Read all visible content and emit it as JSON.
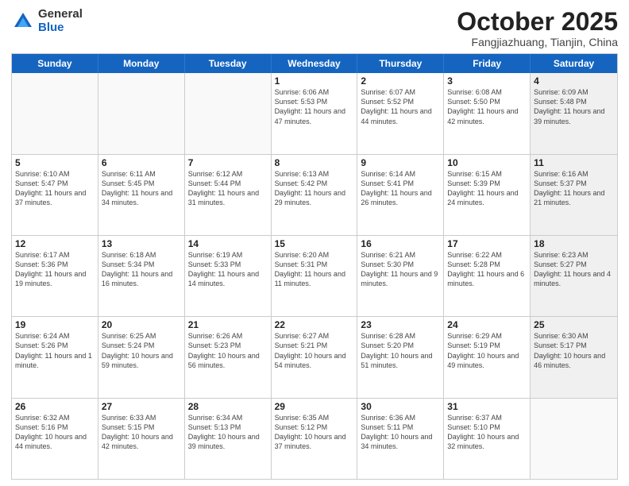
{
  "logo": {
    "general": "General",
    "blue": "Blue"
  },
  "title": "October 2025",
  "subtitle": "Fangjiazhuang, Tianjin, China",
  "days_of_week": [
    "Sunday",
    "Monday",
    "Tuesday",
    "Wednesday",
    "Thursday",
    "Friday",
    "Saturday"
  ],
  "weeks": [
    [
      {
        "day": "",
        "info": "",
        "empty": true
      },
      {
        "day": "",
        "info": "",
        "empty": true
      },
      {
        "day": "",
        "info": "",
        "empty": true
      },
      {
        "day": "1",
        "info": "Sunrise: 6:06 AM\nSunset: 5:53 PM\nDaylight: 11 hours and 47 minutes."
      },
      {
        "day": "2",
        "info": "Sunrise: 6:07 AM\nSunset: 5:52 PM\nDaylight: 11 hours and 44 minutes."
      },
      {
        "day": "3",
        "info": "Sunrise: 6:08 AM\nSunset: 5:50 PM\nDaylight: 11 hours and 42 minutes."
      },
      {
        "day": "4",
        "info": "Sunrise: 6:09 AM\nSunset: 5:48 PM\nDaylight: 11 hours and 39 minutes.",
        "shaded": true
      }
    ],
    [
      {
        "day": "5",
        "info": "Sunrise: 6:10 AM\nSunset: 5:47 PM\nDaylight: 11 hours and 37 minutes."
      },
      {
        "day": "6",
        "info": "Sunrise: 6:11 AM\nSunset: 5:45 PM\nDaylight: 11 hours and 34 minutes."
      },
      {
        "day": "7",
        "info": "Sunrise: 6:12 AM\nSunset: 5:44 PM\nDaylight: 11 hours and 31 minutes."
      },
      {
        "day": "8",
        "info": "Sunrise: 6:13 AM\nSunset: 5:42 PM\nDaylight: 11 hours and 29 minutes."
      },
      {
        "day": "9",
        "info": "Sunrise: 6:14 AM\nSunset: 5:41 PM\nDaylight: 11 hours and 26 minutes."
      },
      {
        "day": "10",
        "info": "Sunrise: 6:15 AM\nSunset: 5:39 PM\nDaylight: 11 hours and 24 minutes."
      },
      {
        "day": "11",
        "info": "Sunrise: 6:16 AM\nSunset: 5:37 PM\nDaylight: 11 hours and 21 minutes.",
        "shaded": true
      }
    ],
    [
      {
        "day": "12",
        "info": "Sunrise: 6:17 AM\nSunset: 5:36 PM\nDaylight: 11 hours and 19 minutes."
      },
      {
        "day": "13",
        "info": "Sunrise: 6:18 AM\nSunset: 5:34 PM\nDaylight: 11 hours and 16 minutes."
      },
      {
        "day": "14",
        "info": "Sunrise: 6:19 AM\nSunset: 5:33 PM\nDaylight: 11 hours and 14 minutes."
      },
      {
        "day": "15",
        "info": "Sunrise: 6:20 AM\nSunset: 5:31 PM\nDaylight: 11 hours and 11 minutes."
      },
      {
        "day": "16",
        "info": "Sunrise: 6:21 AM\nSunset: 5:30 PM\nDaylight: 11 hours and 9 minutes."
      },
      {
        "day": "17",
        "info": "Sunrise: 6:22 AM\nSunset: 5:28 PM\nDaylight: 11 hours and 6 minutes."
      },
      {
        "day": "18",
        "info": "Sunrise: 6:23 AM\nSunset: 5:27 PM\nDaylight: 11 hours and 4 minutes.",
        "shaded": true
      }
    ],
    [
      {
        "day": "19",
        "info": "Sunrise: 6:24 AM\nSunset: 5:26 PM\nDaylight: 11 hours and 1 minute."
      },
      {
        "day": "20",
        "info": "Sunrise: 6:25 AM\nSunset: 5:24 PM\nDaylight: 10 hours and 59 minutes."
      },
      {
        "day": "21",
        "info": "Sunrise: 6:26 AM\nSunset: 5:23 PM\nDaylight: 10 hours and 56 minutes."
      },
      {
        "day": "22",
        "info": "Sunrise: 6:27 AM\nSunset: 5:21 PM\nDaylight: 10 hours and 54 minutes."
      },
      {
        "day": "23",
        "info": "Sunrise: 6:28 AM\nSunset: 5:20 PM\nDaylight: 10 hours and 51 minutes."
      },
      {
        "day": "24",
        "info": "Sunrise: 6:29 AM\nSunset: 5:19 PM\nDaylight: 10 hours and 49 minutes."
      },
      {
        "day": "25",
        "info": "Sunrise: 6:30 AM\nSunset: 5:17 PM\nDaylight: 10 hours and 46 minutes.",
        "shaded": true
      }
    ],
    [
      {
        "day": "26",
        "info": "Sunrise: 6:32 AM\nSunset: 5:16 PM\nDaylight: 10 hours and 44 minutes."
      },
      {
        "day": "27",
        "info": "Sunrise: 6:33 AM\nSunset: 5:15 PM\nDaylight: 10 hours and 42 minutes."
      },
      {
        "day": "28",
        "info": "Sunrise: 6:34 AM\nSunset: 5:13 PM\nDaylight: 10 hours and 39 minutes."
      },
      {
        "day": "29",
        "info": "Sunrise: 6:35 AM\nSunset: 5:12 PM\nDaylight: 10 hours and 37 minutes."
      },
      {
        "day": "30",
        "info": "Sunrise: 6:36 AM\nSunset: 5:11 PM\nDaylight: 10 hours and 34 minutes."
      },
      {
        "day": "31",
        "info": "Sunrise: 6:37 AM\nSunset: 5:10 PM\nDaylight: 10 hours and 32 minutes."
      },
      {
        "day": "",
        "info": "",
        "empty": true,
        "shaded": true
      }
    ]
  ]
}
